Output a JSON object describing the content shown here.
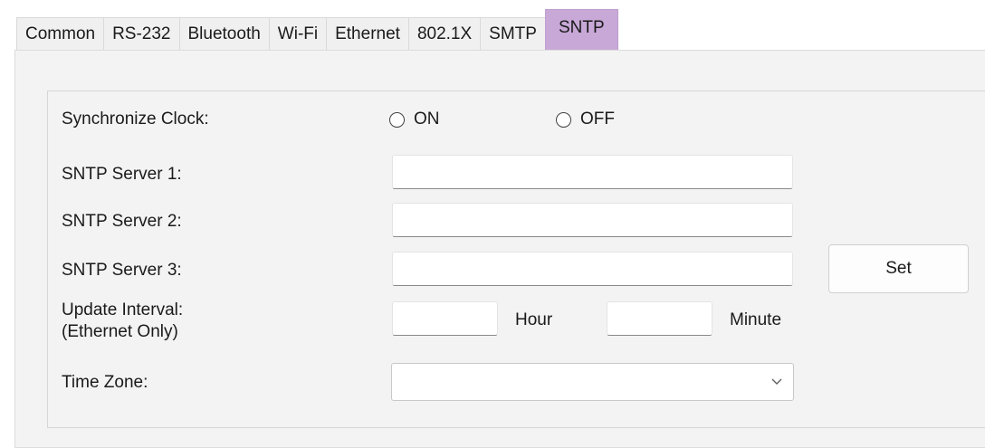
{
  "tabs": [
    {
      "label": "Common"
    },
    {
      "label": "RS-232"
    },
    {
      "label": "Bluetooth"
    },
    {
      "label": "Wi-Fi"
    },
    {
      "label": "Ethernet"
    },
    {
      "label": "802.1X"
    },
    {
      "label": "SMTP"
    },
    {
      "label": "SNTP",
      "active": true
    }
  ],
  "accent_color": "#c7a8d7",
  "form": {
    "sync_clock_label": "Synchronize Clock:",
    "radio_on_label": "ON",
    "radio_off_label": "OFF",
    "server1_label": "SNTP Server 1:",
    "server1_value": "",
    "server2_label": "SNTP Server 2:",
    "server2_value": "",
    "server3_label": "SNTP Server 3:",
    "server3_value": "",
    "update_interval_label": "Update Interval:",
    "update_interval_sublabel": "(Ethernet Only)",
    "hour_value": "",
    "hour_label": "Hour",
    "minute_value": "",
    "minute_label": "Minute",
    "time_zone_label": "Time Zone:",
    "time_zone_value": "",
    "set_button": "Set"
  },
  "icons": {
    "dropdown": "chevron-down-icon"
  }
}
